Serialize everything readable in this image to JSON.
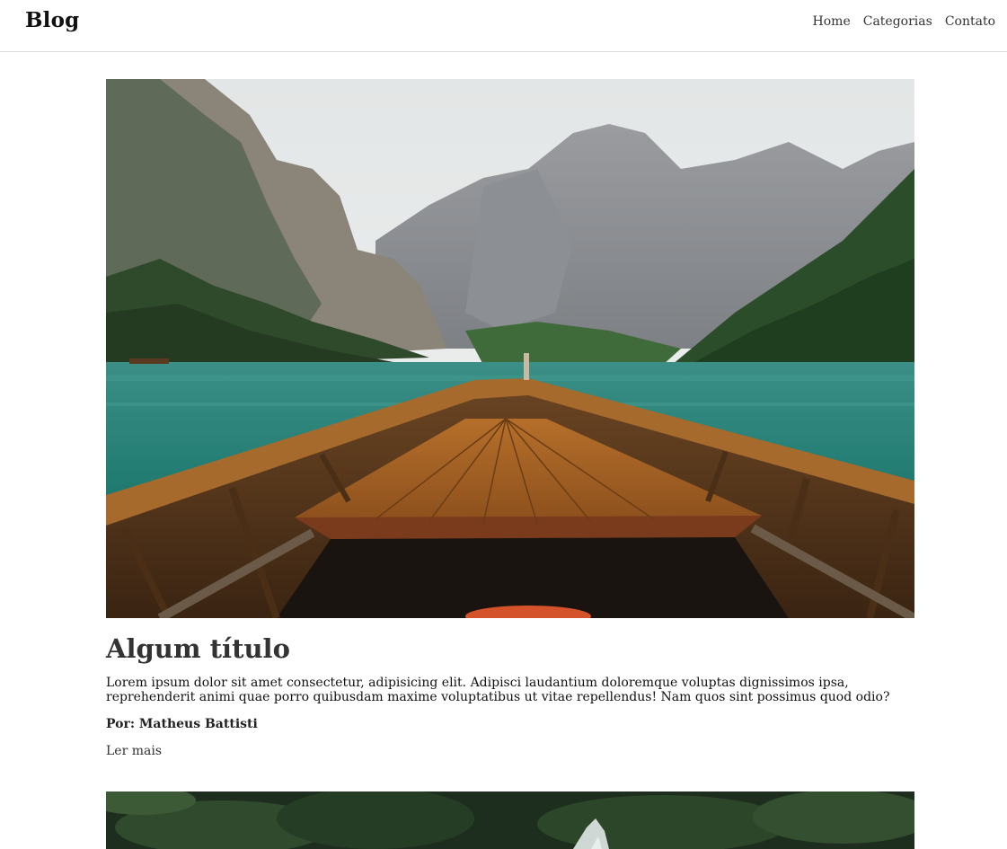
{
  "navbar": {
    "brand": "Blog",
    "links": [
      {
        "label": "Home"
      },
      {
        "label": "Categorias"
      },
      {
        "label": "Contato"
      }
    ]
  },
  "posts": [
    {
      "image_icon": "lake-boat-mountains-image",
      "title": "Algum título",
      "excerpt": "Lorem ipsum dolor sit amet consectetur, adipisicing elit. Adipisci laudantium doloremque voluptas dignissimos ipsa, reprehenderit animi quae porro quibusdam maxime voluptatibus ut vitae repellendus! Nam quos sint possimus quod odio?",
      "author_prefix": "Por:",
      "author_name": "Matheus Battisti",
      "read_more": "Ler mais"
    },
    {
      "image_icon": "forest-waterfall-image"
    }
  ]
}
